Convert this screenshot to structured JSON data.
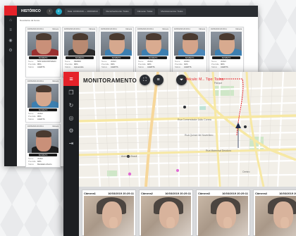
{
  "historico": {
    "title": "HISTÓRICO",
    "filters": [
      "Data: 16/03/2019 — 16/03/2019",
      "Reconhecimento: Todos",
      "Câmeras: Todas",
      "Monitoramentos: Todos"
    ],
    "subtitle": "Resultados da busca",
    "cards": [
      {
        "cam": "16/03/2019 20:29:11",
        "tag": "Câmera",
        "name": "SUSPEITO",
        "rows": [
          [
            "Nome",
            "NÃO ENCONTRADO"
          ],
          [
            "Precisão",
            "95%"
          ],
          [
            "Status",
            "ALERTA"
          ]
        ]
      },
      {
        "cam": "16/03/2019 20:29:11",
        "tag": "Câmera",
        "name": "SUSPEITO",
        "rows": [
          [
            "Nome",
            "PEDRO"
          ],
          [
            "Precisão",
            "96%"
          ],
          [
            "Status",
            "Apreensão"
          ]
        ]
      },
      {
        "cam": "16/03/2019 20:29:11",
        "tag": "Câmera",
        "name": "SUSPEITO",
        "rows": [
          [
            "Nome",
            "JOAO"
          ],
          [
            "Precisão",
            "93%"
          ],
          [
            "Status",
            "ALERTA"
          ]
        ]
      },
      {
        "cam": "16/03/2019 20:29:11",
        "tag": "Câmera",
        "name": "SUSPEITO",
        "rows": [
          [
            "Nome",
            "JOAO"
          ],
          [
            "Precisão",
            "92%"
          ],
          [
            "Status",
            "ALERTA"
          ]
        ]
      },
      {
        "cam": "16/03/2019 20:29:11",
        "tag": "Câmera",
        "name": "SUSPEITO",
        "rows": [
          [
            "Nome",
            "JOAO"
          ],
          [
            "Precisão",
            "91%"
          ],
          [
            "Status",
            "ALERTA"
          ]
        ]
      },
      {
        "cam": "16/03/2019 20:29:11",
        "tag": "Câmera",
        "name": "SUSPEITO",
        "rows": [
          [
            "Nome",
            "JOAO"
          ],
          [
            "Precisão",
            "90%"
          ],
          [
            "Status",
            "ALERTA"
          ]
        ]
      }
    ],
    "left_cards": [
      {
        "cam": "16/03/2019 20:29:11",
        "tag": "Câmera",
        "name": "SUSPEITO",
        "rows": [
          [
            "Nome",
            "JOAO"
          ],
          [
            "Precisão",
            "95%"
          ],
          [
            "Status",
            "ALERTA"
          ]
        ]
      },
      {
        "cam": "16/03/2019 20:29:11",
        "tag": "Câmera",
        "name": "SUSPEITO",
        "rows": [
          [
            "Nome",
            "JOAO"
          ],
          [
            "Precisão",
            "94%"
          ],
          [
            "Status",
            "Mandado Aberto"
          ]
        ]
      }
    ]
  },
  "monitoramento": {
    "title": "MONITORAMENTO",
    "red_label": "Veículo: M... Tipo: Todos",
    "map_labels": [
      "Rua Comendador João Correa",
      "Avenida Brasil",
      "Rua Marechal Deodoro",
      "Centro",
      "Rua Quinze de Novembro",
      "Parque"
    ],
    "cameras": [
      {
        "name": "Câmera1",
        "ts": "16/03/2019 20:29:11"
      },
      {
        "name": "Câmera2",
        "ts": "16/03/2019 20:29:11"
      },
      {
        "name": "Câmera3",
        "ts": "16/03/2019 20:29:11"
      },
      {
        "name": "Câmera4",
        "ts": "16/03/2019 20:29:11"
      }
    ]
  },
  "colors": {
    "brand": "#e52229",
    "sidebar": "#1d1f22",
    "accent": "#20a7c4"
  },
  "icons": {
    "logo": "menu-icon",
    "side": [
      "layers-icon",
      "refresh-icon",
      "camera-icon",
      "gear-icon",
      "logout-icon"
    ]
  }
}
